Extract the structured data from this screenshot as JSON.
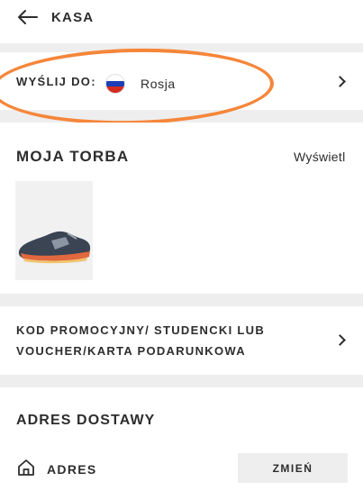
{
  "header": {
    "title": "KASA"
  },
  "shipping": {
    "label": "WYŚLIJ DO:",
    "country": "Rosja"
  },
  "bag": {
    "title": "MOJA TORBA",
    "view_link": "Wyświetl"
  },
  "promo": {
    "line1": "KOD PROMOCYJNY/ STUDENCKI LUB",
    "line2": "VOUCHER/KARTA PODARUNKOWA"
  },
  "delivery": {
    "title": "ADRES DOSTAWY",
    "address_label": "ADRES",
    "change_button": "ZMIEŃ"
  },
  "colors": {
    "annotation": "#f5863a",
    "page_bg": "#eeeeee",
    "text": "#2d2d2d"
  },
  "icons": {
    "back": "arrow-left-icon",
    "chevron": "chevron-right-icon",
    "flag": "russia-flag-icon",
    "home": "home-icon"
  }
}
